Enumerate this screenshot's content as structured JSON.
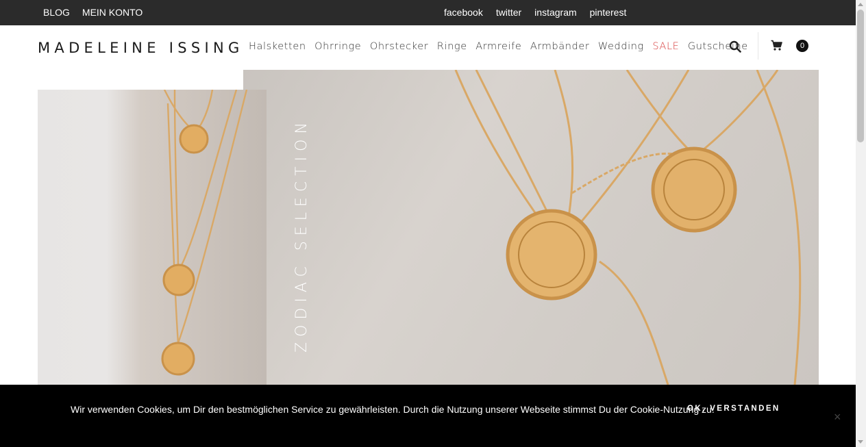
{
  "topbar": {
    "left_links": [
      "BLOG",
      "MEIN KONTO"
    ],
    "social_links": [
      "facebook",
      "twitter",
      "instagram",
      "pinterest"
    ]
  },
  "header": {
    "logo": "MADELEINE ISSING",
    "nav": [
      {
        "label": "Halsketten"
      },
      {
        "label": "Ohrringe"
      },
      {
        "label": "Ohrstecker"
      },
      {
        "label": "Ringe"
      },
      {
        "label": "Armreife"
      },
      {
        "label": "Armbänder"
      },
      {
        "label": "Wedding"
      },
      {
        "label": "SALE",
        "highlight": true
      },
      {
        "label": "Gutscheine"
      }
    ],
    "search_icon": "search-icon",
    "cart_icon": "cart-icon",
    "cart_count": "0"
  },
  "hero": {
    "vertical_text": "ZODIAC SELECTION"
  },
  "cookie": {
    "text": "Wir verwenden Cookies, um Dir den bestmöglichen Service zu gewährleisten. Durch die Nutzung unserer Webseite stimmst Du der Cookie-Nutzung zu.",
    "ok_label": "OK, VERSTANDEN",
    "close_label": "×"
  },
  "colors": {
    "topbar": "#2b2b2b",
    "sale": "#d63a3a",
    "gold": "#d9a866"
  }
}
